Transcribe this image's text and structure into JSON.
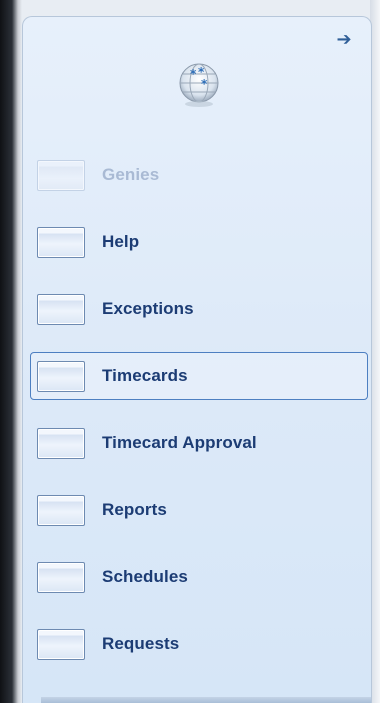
{
  "panel": {
    "collapse_icon": "arrow-right-icon",
    "logo_icon": "globe-snowflake-icon",
    "items": [
      {
        "label": "Genies",
        "disabled": true
      },
      {
        "label": "Help"
      },
      {
        "label": "Exceptions"
      },
      {
        "label": "Timecards",
        "selected": true
      },
      {
        "label": "Timecard Approval"
      },
      {
        "label": "Reports"
      },
      {
        "label": "Schedules"
      },
      {
        "label": "Requests"
      }
    ]
  },
  "colors": {
    "accent": "#1c3c74",
    "selected_border": "#4d7fc1",
    "panel_bg": "#dce9f8"
  }
}
